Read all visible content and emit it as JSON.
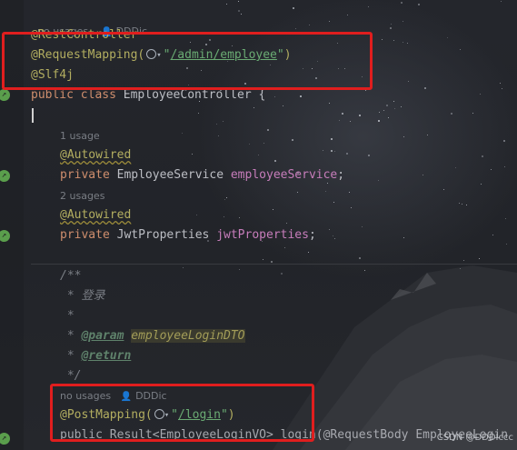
{
  "editor": {
    "class_hint": {
      "usages": "no usages",
      "author": "DDDic"
    },
    "lines": {
      "rest_controller": "@RestController",
      "request_mapping_prefix": "@RequestMapping(",
      "request_mapping_path": "/admin/employee",
      "request_mapping_suffix": ")",
      "slf4j": "@Slf4j",
      "class_kw_public": "public",
      "class_kw_class": "class",
      "class_name": "EmployeeController {",
      "usage1": "1 usage",
      "autowired1": "@Autowired",
      "field1_kw": "private",
      "field1_type": "EmployeeService",
      "field1_name": "employeeService",
      "field1_end": ";",
      "usage2": "2 usages",
      "autowired2": "@Autowired",
      "field2_kw": "private",
      "field2_type": "JwtProperties",
      "field2_name": "jwtProperties",
      "field2_end": ";",
      "doc_open": "/**",
      "doc_title": " * 登录",
      "doc_blank": " *",
      "doc_param_star": " * ",
      "doc_param_tag": "@param",
      "doc_param_name": "employeeLoginDTO",
      "doc_return_star": " * ",
      "doc_return_tag": "@return",
      "doc_close": " */",
      "method_hint_usages": "no usages",
      "method_hint_author": "DDDic",
      "post_mapping_prefix": "@PostMapping(",
      "post_mapping_path": "/login",
      "post_mapping_suffix": ")",
      "method_sig": "public Result<EmployeeLoginVO> login(@RequestBody EmployeeLogin"
    }
  },
  "watermark": "CSDN @DDDIccc",
  "colors": {
    "highlight_box": "#e01e1e",
    "keyword": "#cf8e6d",
    "annotation": "#b3ae60",
    "string": "#6aab73",
    "field": "#c77dbb"
  },
  "icons": [
    "bean-gutter-icon",
    "web-url-globe-icon",
    "user-icon"
  ]
}
